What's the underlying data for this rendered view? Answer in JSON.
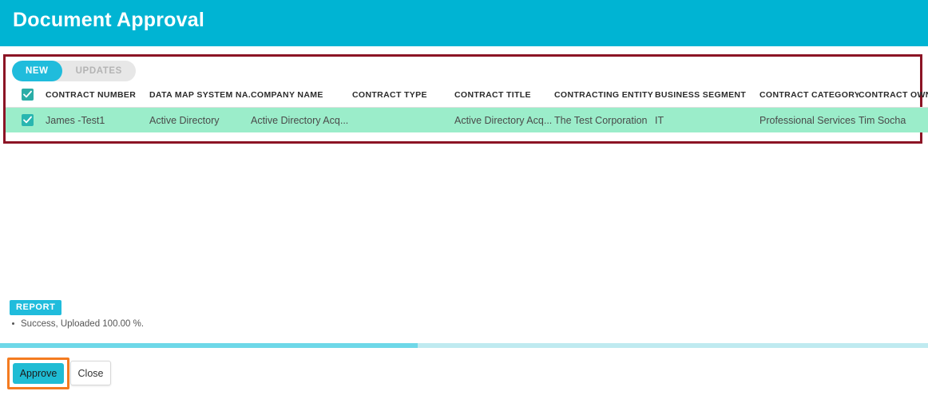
{
  "header": {
    "title": "Document Approval"
  },
  "tabs": [
    {
      "label": "NEW",
      "active": true
    },
    {
      "label": "UPDATES",
      "active": false
    }
  ],
  "table": {
    "select_all_checked": true,
    "columns": [
      "CONTRACT NUMBER",
      "DATA MAP SYSTEM NA...",
      "COMPANY NAME",
      "CONTRACT TYPE",
      "CONTRACT TITLE",
      "CONTRACTING ENTITY",
      "BUSINESS SEGMENT",
      "CONTRACT CATEGORY",
      "CONTRACT OWNER"
    ],
    "rows": [
      {
        "selected": true,
        "contract_number": "James -Test1",
        "data_map_system_name": "Active Directory",
        "company_name": "Active Directory Acq...",
        "contract_type": "",
        "contract_title": "Active Directory Acq...",
        "contracting_entity": "The Test Corporation",
        "business_segment": "IT",
        "contract_category": "Professional Services",
        "contract_owner": "Tim Socha"
      }
    ]
  },
  "report": {
    "badge_label": "REPORT",
    "messages": [
      "Success, Uploaded 100.00 %."
    ]
  },
  "progress": {
    "percent": 45
  },
  "footer": {
    "approve_label": "Approve",
    "close_label": "Close"
  },
  "colors": {
    "header_cyan": "#00b4d3",
    "accent_cyan": "#20bcdc",
    "row_green": "#9bedca",
    "annotation_red": "#8c1425",
    "annotation_orange": "#f47b20",
    "checkbox_teal": "#2aada7"
  }
}
